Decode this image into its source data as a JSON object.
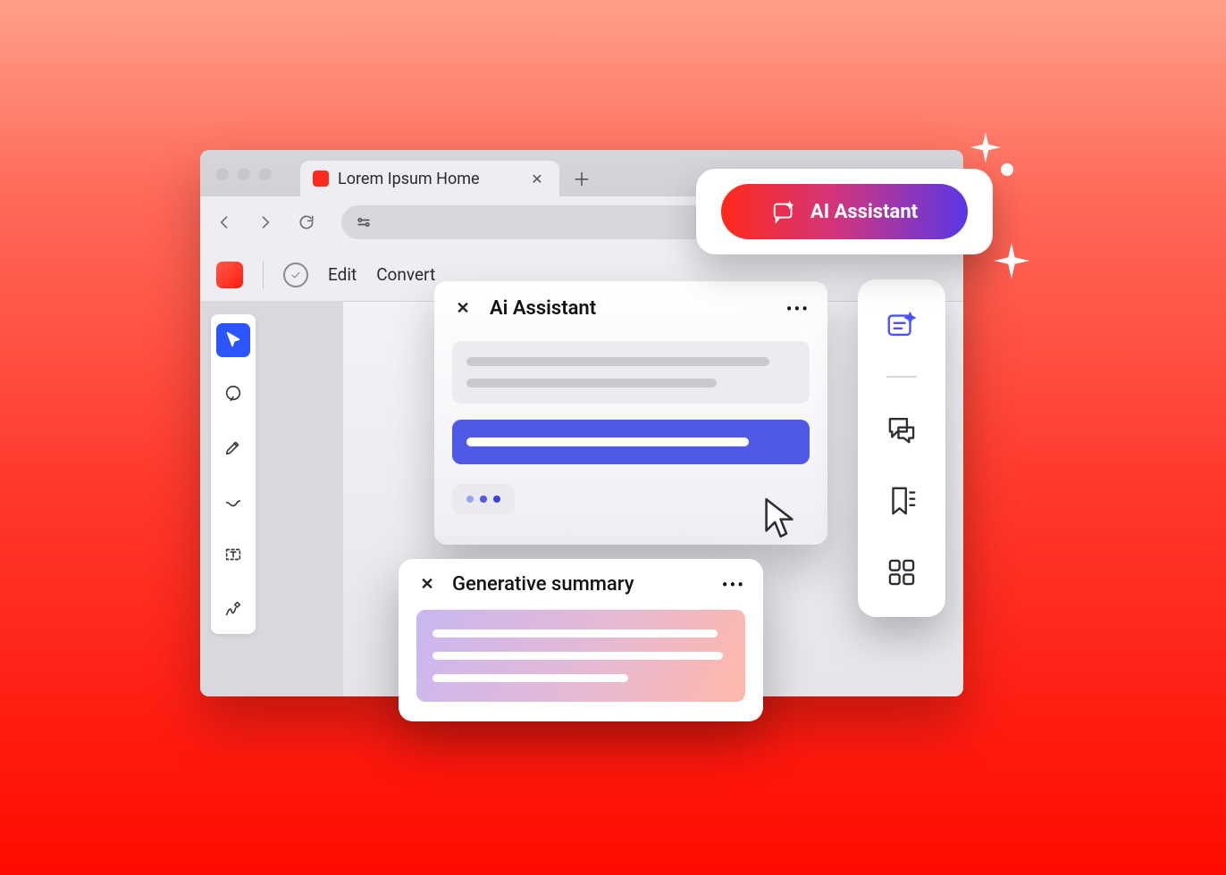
{
  "browser": {
    "tab_title": "Lorem Ipsum Home"
  },
  "app": {
    "menu": {
      "edit": "Edit",
      "convert": "Convert"
    }
  },
  "ai_panel": {
    "title": "Ai Assistant"
  },
  "gen_panel": {
    "title": "Generative summary"
  },
  "ai_pill": {
    "label": "AI Assistant"
  }
}
